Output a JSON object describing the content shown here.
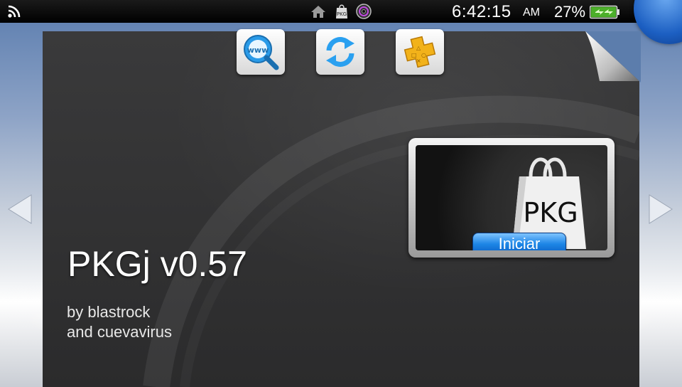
{
  "status_bar": {
    "time": "6:42:15",
    "ampm": "AM",
    "battery_percent": "27%",
    "battery_level": 0.27,
    "notification_icons": [
      "home-icon",
      "pkg-icon",
      "disc-icon"
    ],
    "wifi_icon": "wifi-icon"
  },
  "livearea": {
    "top_buttons": [
      {
        "icon": "www-browser-icon"
      },
      {
        "icon": "refresh-icon"
      },
      {
        "icon": "ps-plus-icon"
      }
    ],
    "app_icon_text": "PKG",
    "start_button": "Iniciar",
    "title": "PKGj v0.57",
    "byline_line1": "by blastrock",
    "byline_line2": "and cuevavirus"
  },
  "colors": {
    "accent": "#1d86e6",
    "card_bg": "#2f2f30",
    "battery": "#4caf2a"
  }
}
